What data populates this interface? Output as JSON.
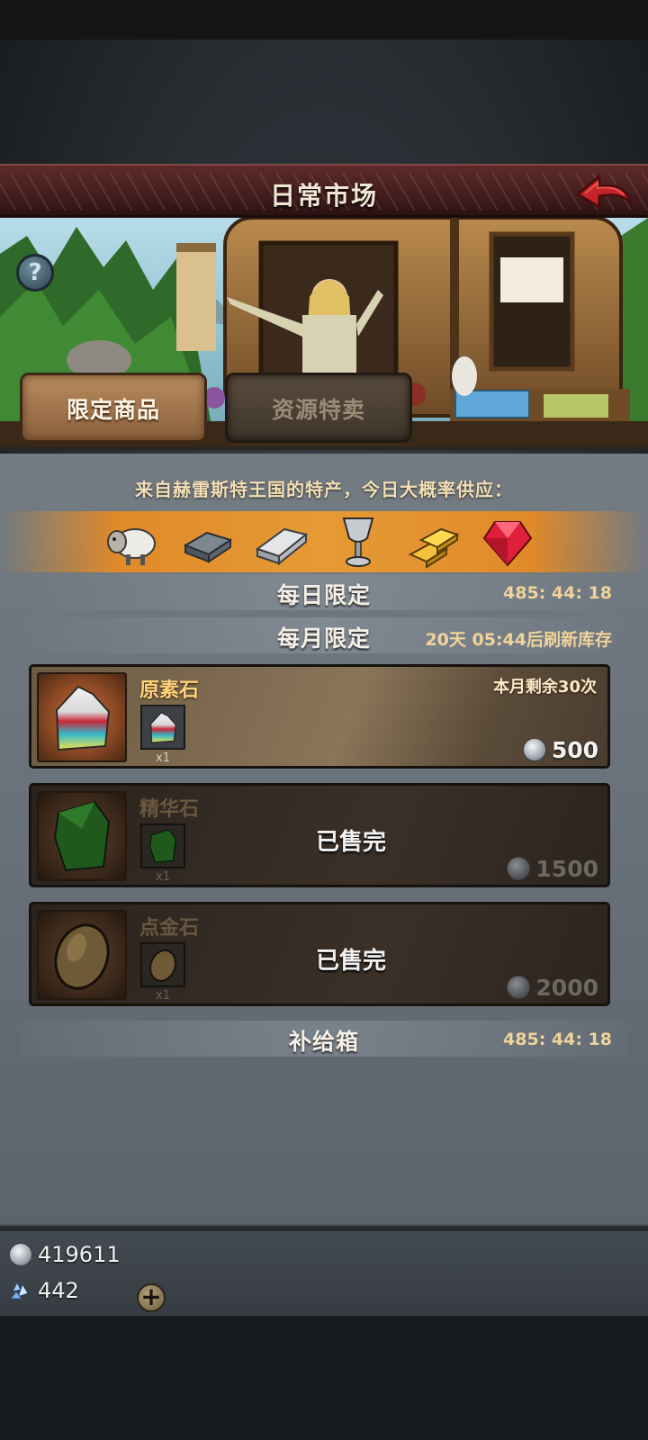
{
  "header": {
    "title": "日常市场",
    "back_icon": "back-arrow-icon"
  },
  "banner": {
    "help_label": "?",
    "tabs": [
      {
        "label": "限定商品",
        "active": true
      },
      {
        "label": "资源特卖",
        "active": false
      }
    ]
  },
  "specialty": {
    "text": "来自赫雷斯特王国的特产，今日大概率供应：",
    "resources": [
      "sheep-icon",
      "iron-ingot-icon",
      "silver-ingot-icon",
      "goblet-icon",
      "gold-bars-icon",
      "ruby-icon"
    ]
  },
  "sections": {
    "daily": {
      "name": "每日限定",
      "timer": "485: 44: 18"
    },
    "monthly": {
      "name": "每月限定",
      "refresh": "20天 05:44后刷新库存"
    },
    "supply": {
      "name": "补给箱",
      "timer": "485: 44: 18"
    }
  },
  "items": [
    {
      "name": "原素石",
      "qty": "x1",
      "remaining": "本月剩余30次",
      "price": "500",
      "sold_out": false
    },
    {
      "name": "精华石",
      "qty": "x1",
      "price": "1500",
      "sold_out": true,
      "sold_out_label": "已售完"
    },
    {
      "name": "点金石",
      "qty": "x1",
      "price": "2000",
      "sold_out": true,
      "sold_out_label": "已售完"
    }
  ],
  "balance": {
    "silver": "419611",
    "gems": "442",
    "add_label": "+"
  },
  "colors": {
    "title_bar": "#4a2020",
    "orange_band": "#e69a34",
    "item_name": "#ffd37a",
    "timer": "#f0d39a"
  }
}
